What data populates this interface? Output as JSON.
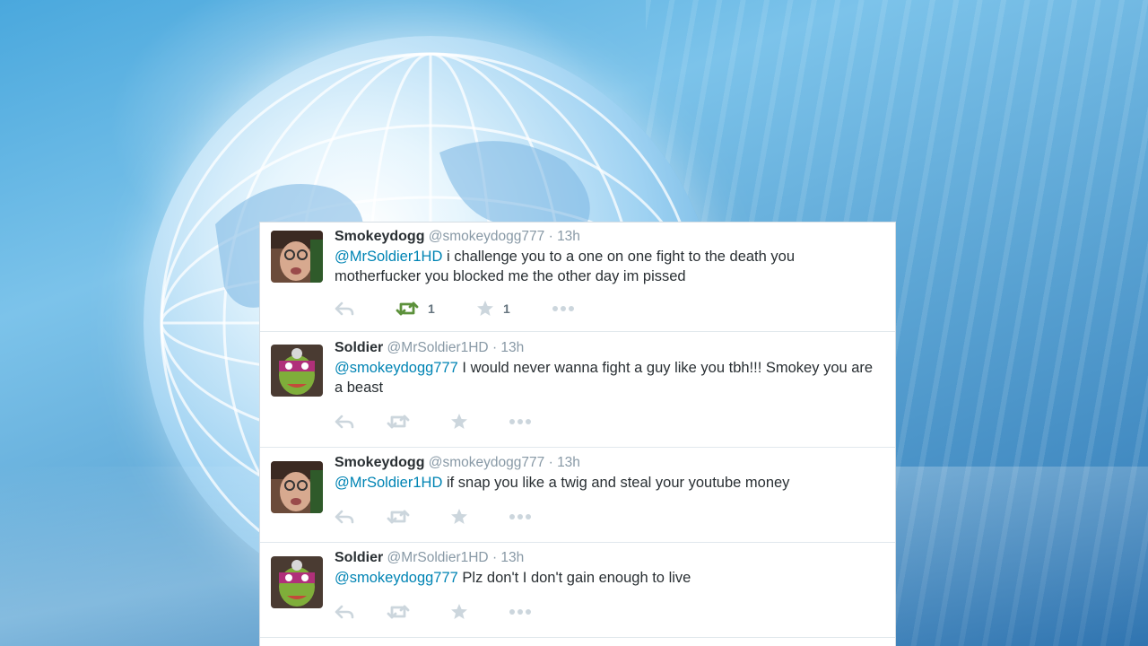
{
  "colors": {
    "mention": "#0084b4",
    "retweet_active": "#5c913b",
    "action_idle": "#ccd6dd",
    "name": "#292f33",
    "meta": "#8899a6"
  },
  "tweets": [
    {
      "name": "Smokeydogg",
      "handle": "@smokeydogg777",
      "dot": "·",
      "time": "13h",
      "mention": "@MrSoldier1HD",
      "text": " i challenge you to a one on one fight to the death you motherfucker you blocked me the other day im pissed",
      "retweet_count": "1",
      "favorite_count": "1",
      "retweeted": true,
      "avatar_icon": "face-avatar"
    },
    {
      "name": "Soldier",
      "handle": "@MrSoldier1HD",
      "dot": "·",
      "time": "13h",
      "mention": "@smokeydogg777",
      "text": " I would never wanna fight a guy like you tbh!!! Smokey you are a beast",
      "retweet_count": "",
      "favorite_count": "",
      "retweeted": false,
      "avatar_icon": "turtle-avatar"
    },
    {
      "name": "Smokeydogg",
      "handle": "@smokeydogg777",
      "dot": "·",
      "time": "13h",
      "mention": "@MrSoldier1HD",
      "text": " if snap you like a twig and steal your youtube money",
      "retweet_count": "",
      "favorite_count": "",
      "retweeted": false,
      "avatar_icon": "face-avatar"
    },
    {
      "name": "Soldier",
      "handle": "@MrSoldier1HD",
      "dot": "·",
      "time": "13h",
      "mention": "@smokeydogg777",
      "text": " Plz don't I don't gain enough to live",
      "retweet_count": "",
      "favorite_count": "",
      "retweeted": false,
      "avatar_icon": "turtle-avatar"
    }
  ]
}
